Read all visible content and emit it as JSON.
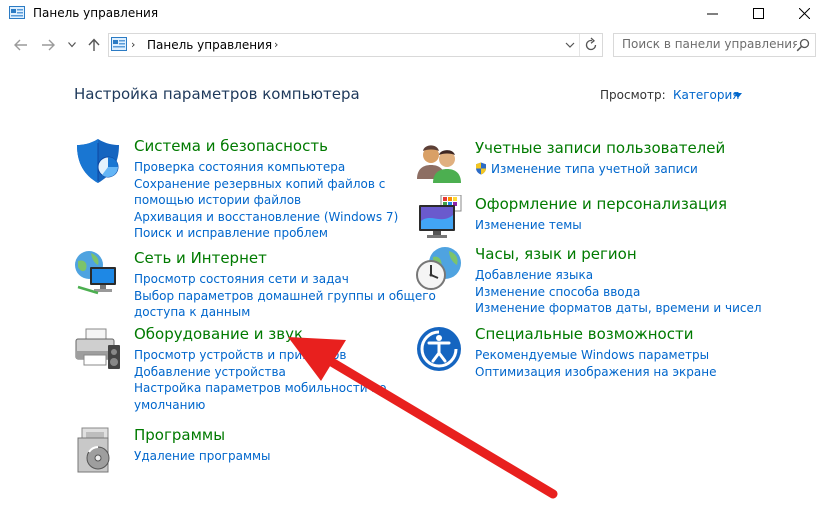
{
  "window": {
    "title": "Панель управления"
  },
  "address": {
    "crumb": "Панель управления",
    "separator": "›"
  },
  "search": {
    "placeholder": "Поиск в панели управления"
  },
  "page": {
    "heading": "Настройка параметров компьютера",
    "view_label": "Просмотр:",
    "view_value": "Категория"
  },
  "left_categories": [
    {
      "title": "Система и безопасность",
      "icon": "shield-icon",
      "links": [
        "Проверка состояния компьютера",
        "Сохранение резервных копий файлов с",
        "помощью истории файлов",
        "Архивация и восстановление (Windows 7)",
        "Поиск и исправление проблем"
      ]
    },
    {
      "title": "Сеть и Интернет",
      "icon": "network-globe-icon",
      "links": [
        "Просмотр состояния сети и задач",
        "Выбор параметров домашней группы и общего",
        "доступа к данным"
      ]
    },
    {
      "title": "Оборудование и звук",
      "icon": "printer-icon",
      "links": [
        "Просмотр устройств и принтеров",
        "Добавление устройства",
        "Настройка параметров мобильности по",
        "умолчанию"
      ]
    },
    {
      "title": "Программы",
      "icon": "programs-disc-icon",
      "links": [
        "Удаление программы"
      ]
    }
  ],
  "right_categories": [
    {
      "title": "Учетные записи пользователей",
      "icon": "users-icon",
      "links": [
        "Изменение типа учетной записи"
      ]
    },
    {
      "title": "Оформление и персонализация",
      "icon": "monitor-palette-icon",
      "links": [
        "Изменение темы"
      ]
    },
    {
      "title": "Часы, язык и регион",
      "icon": "clock-globe-icon",
      "links": [
        "Добавление языка",
        "Изменение способа ввода",
        "Изменение форматов даты, времени и чисел"
      ]
    },
    {
      "title": "Специальные возможности",
      "icon": "accessibility-icon",
      "links": [
        "Рекомендуемые Windows параметры",
        "Оптимизация изображения на экране"
      ]
    }
  ],
  "colors": {
    "category_title": "#007a00",
    "link": "#0066cc",
    "heading": "#1e395b",
    "annotation_arrow": "#e8201e"
  }
}
